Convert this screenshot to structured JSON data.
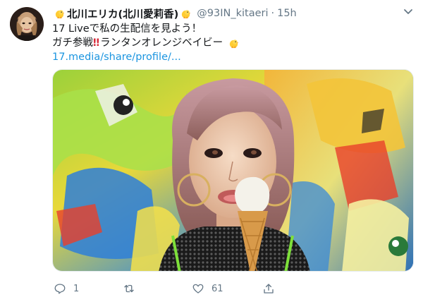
{
  "user": {
    "display_name": "北川エリカ(北川愛莉香)",
    "handle": "@93IN_kitaeri",
    "separator": "·",
    "time": "15h"
  },
  "tweet": {
    "line1": "17 Liveで私の生配信を見よう！",
    "line2_prefix": "ガチ参戦",
    "line2_bang": "‼",
    "line2_suffix": "ランタンオレンジベイビー",
    "link": "17.media/share/profile/..."
  },
  "actions": {
    "reply_count": "1",
    "retweet_count": "",
    "like_count": "61"
  },
  "icons": {
    "name_emoji": "baby-chick-icon",
    "reply": "reply-icon",
    "retweet": "retweet-icon",
    "like": "heart-icon",
    "share": "share-icon",
    "menu": "chevron-down-icon"
  },
  "colors": {
    "link": "#1b95e0",
    "secondary_text": "#657786",
    "primary_text": "#14171a",
    "border": "#e6ecf0"
  }
}
